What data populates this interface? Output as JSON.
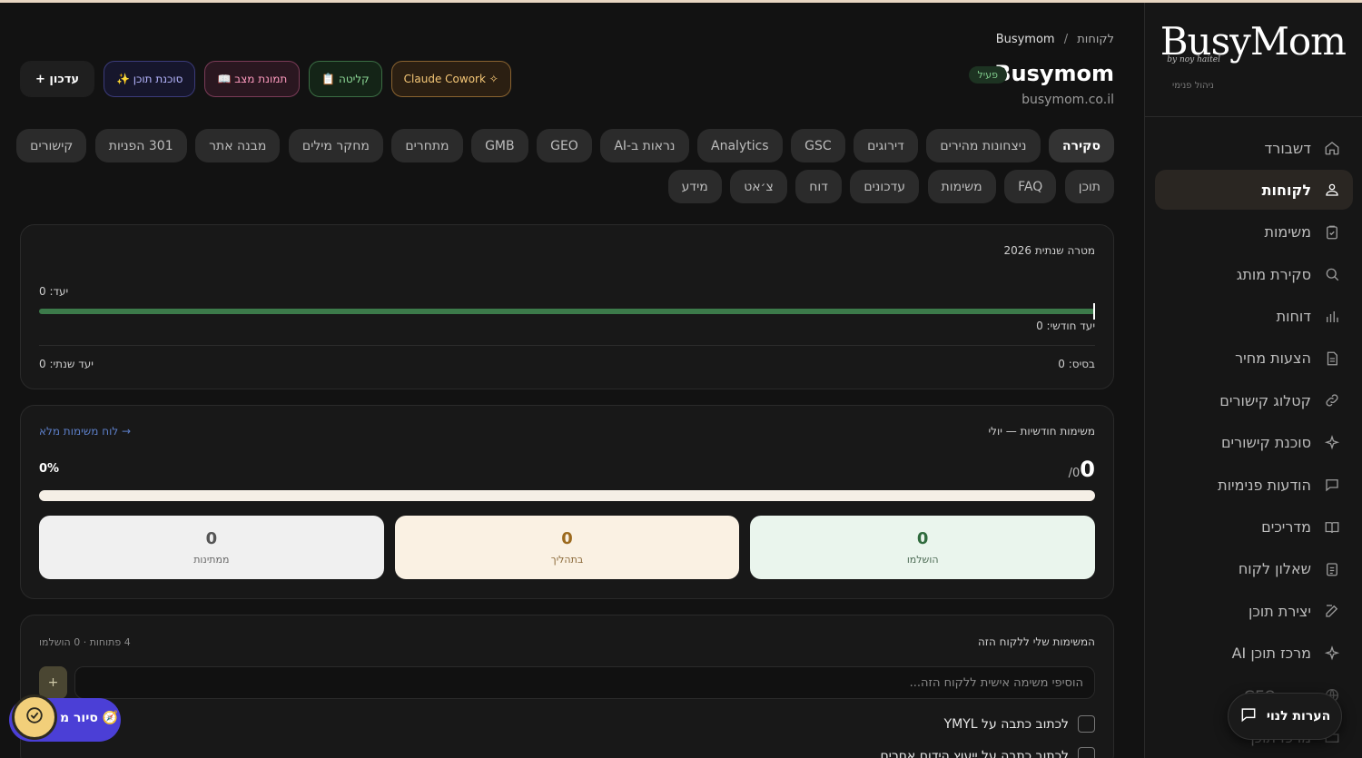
{
  "sidebar": {
    "logo": "BusyMom",
    "logo_sub": "by noy haitel",
    "caption": "ניהול פנימי",
    "items": [
      {
        "label": "דשבורד",
        "icon": "home-icon"
      },
      {
        "label": "לקוחות",
        "icon": "users-icon",
        "active": true
      },
      {
        "label": "משימות",
        "icon": "clipboard-check-icon"
      },
      {
        "label": "סקירת מותג",
        "icon": "search-icon"
      },
      {
        "label": "דוחות",
        "icon": "bar-chart-icon"
      },
      {
        "label": "הצעות מחיר",
        "icon": "document-icon"
      },
      {
        "label": "קטלוג קישורים",
        "icon": "link-icon"
      },
      {
        "label": "סוכנת קישורים",
        "icon": "sparkles-icon"
      },
      {
        "label": "הודעות פנימיות",
        "icon": "chat-bubble-icon"
      },
      {
        "label": "מדריכים",
        "icon": "book-icon"
      },
      {
        "label": "שאלון לקוח",
        "icon": "clipboard-list-icon"
      },
      {
        "label": "יצירת תוכן",
        "icon": "edit-icon"
      },
      {
        "label": "מרכז תוכן AI",
        "icon": "sparkles-icon"
      },
      {
        "label": "מרכז GEO",
        "icon": "globe-icon"
      },
      {
        "label": "מרכז תוכן",
        "icon": "folder-icon"
      }
    ]
  },
  "header": {
    "breadcrumb_parent": "לקוחות",
    "breadcrumb_sep": "/",
    "breadcrumb_current": "Busymom",
    "title": "Busymom",
    "status": "פעיל",
    "url": "busymom.co.il"
  },
  "actions": {
    "update": "+ עדכון",
    "agent": "✨ סוכנת תוכן",
    "mood": "📖 תמונת מצב",
    "intake": "📋 קליטה",
    "cowork": "Claude Cowork ✧"
  },
  "tabs_row1": [
    "סקירה",
    "ניצחונות מהירים",
    "דירוגים",
    "GSC",
    "Analytics",
    "נראות ב-AI",
    "GEO",
    "GMB",
    "מתחרים",
    "מחקר מילים",
    "מבנה אתר",
    "301 הפניות",
    "קישורים"
  ],
  "tabs_row2": [
    "תוכן",
    "FAQ",
    "משימות",
    "עדכונים",
    "דוח",
    "צ׳אט",
    "מידע"
  ],
  "goal_card": {
    "title": "מטרה שנתית 2026",
    "target": "יעד: 0",
    "monthly": "יעד חודשי: 0",
    "annual": "יעד שנתי: 0",
    "base": "בסיס: 0",
    "progress": 1.0
  },
  "monthly_card": {
    "title": "משימות חודשיות — יולי",
    "link": "→ לוח משימות מלא",
    "count": "0",
    "of": "/0",
    "percent": "0%",
    "progress": 0,
    "stats": [
      {
        "value": "0",
        "label": "הושלמו"
      },
      {
        "value": "0",
        "label": "בתהליך"
      },
      {
        "value": "0",
        "label": "ממתינות"
      }
    ]
  },
  "my_tasks": {
    "title": "המשימות שלי ללקוח הזה",
    "summary": "4 פתוחות · 0 הושלמו",
    "placeholder": "הוסיפי משימה אישית ללקוח הזה...",
    "add": "+",
    "tasks": [
      "לכתוב כתבה על YMYL",
      "לכתוב כתבה על ייעוץ הידום אחרים"
    ]
  },
  "floating": {
    "tour": "🧭 סיור מ",
    "feedback": "הערות לנוי"
  },
  "colors": {
    "accent_green": "#3c7a4a",
    "tour_purple": "#4b3fd6",
    "check_yellow": "#f2cf7a"
  }
}
